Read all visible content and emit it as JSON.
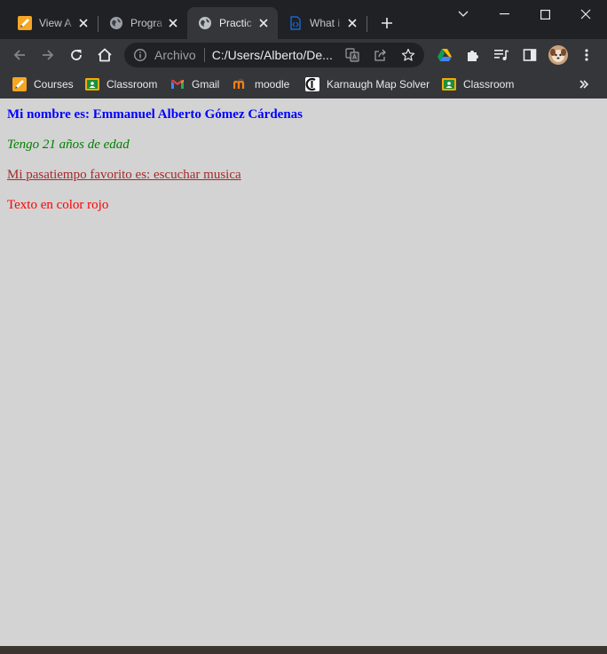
{
  "tabs": [
    {
      "title": "View A",
      "icon": "pencil-icon",
      "active": false
    },
    {
      "title": "Progra",
      "icon": "globe-icon",
      "active": false
    },
    {
      "title": "Practic",
      "icon": "globe-icon",
      "active": true
    },
    {
      "title": "What i",
      "icon": "code-file-icon",
      "active": false
    }
  ],
  "addressbar": {
    "scheme_label": "Archivo",
    "url": "C:/Users/Alberto/De..."
  },
  "bookmarks": [
    {
      "label": "Courses",
      "icon": "pencil-icon"
    },
    {
      "label": "Classroom",
      "icon": "classroom-icon"
    },
    {
      "label": "Gmail",
      "icon": "gmail-icon"
    },
    {
      "label": "moodle",
      "icon": "moodle-icon"
    },
    {
      "label": "Karnaugh Map Solver",
      "icon": "karnaugh-icon"
    },
    {
      "label": "Classroom",
      "icon": "classroom-icon"
    }
  ],
  "page": {
    "line1": "Mi nombre es: Emmanuel Alberto Gómez Cárdenas",
    "line2": "Tengo 21 años de edad",
    "line3": "Mi pasatiempo favorito es: escuchar musica",
    "line4": "Texto en color rojo"
  },
  "colors": {
    "page_background": "#d3d3d3",
    "line1": "#0000ff",
    "line2": "#008000",
    "line3": "#a52a2a",
    "line4": "#ff0000"
  }
}
